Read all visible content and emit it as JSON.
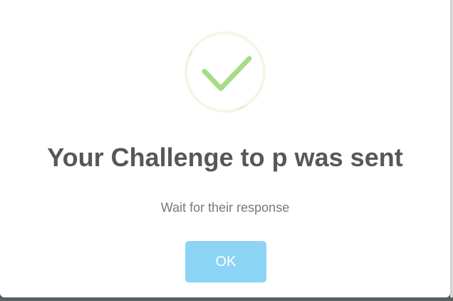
{
  "dialog": {
    "title": "Your Challenge to p was sent",
    "message": "Wait for their response",
    "ok_label": "OK",
    "icon": "success-check-icon"
  },
  "colors": {
    "success_green": "#a5dc86",
    "success_ring": "#eef8e8",
    "button_bg": "#8cd4f5",
    "title_text": "#575757",
    "message_text": "#797979"
  }
}
